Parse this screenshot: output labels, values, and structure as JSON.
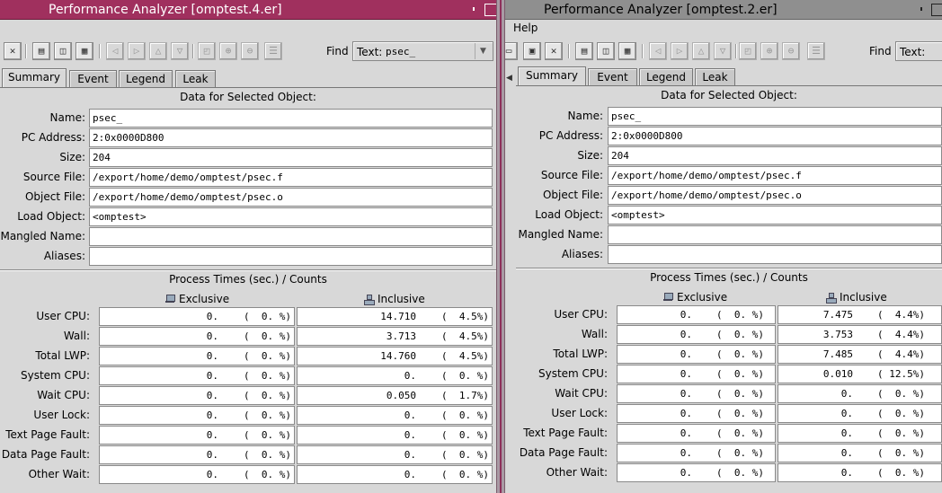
{
  "panels": [
    {
      "id": "A",
      "window_title": "Performance Analyzer [omptest.4.er]",
      "menu": null,
      "find": {
        "label": "Find",
        "text_label": "Text:",
        "value": "psec_"
      },
      "tabs": [
        "Summary",
        "Event",
        "Legend",
        "Leak"
      ],
      "selected_tab": "Summary",
      "object_section_title": "Data for Selected Object:",
      "fields": [
        {
          "label": "Name:",
          "value": "psec_"
        },
        {
          "label": "PC Address:",
          "value": "2:0x0000D800"
        },
        {
          "label": "Size:",
          "value": "204"
        },
        {
          "label": "Source File:",
          "value": "/export/home/demo/omptest/psec.f"
        },
        {
          "label": "Object File:",
          "value": "/export/home/demo/omptest/psec.o"
        },
        {
          "label": "Load Object:",
          "value": "<omptest>"
        },
        {
          "label": "Mangled Name:",
          "value": ""
        },
        {
          "label": "Aliases:",
          "value": ""
        }
      ],
      "metrics_section_title": "Process Times (sec.) / Counts",
      "exclusive_header": "Exclusive",
      "inclusive_header": "Inclusive",
      "metrics": [
        {
          "label": "User CPU:",
          "excl": "0.",
          "excl_pct": "(  0. %)",
          "incl": "14.710",
          "incl_pct": "(  4.5%)"
        },
        {
          "label": "Wall:",
          "excl": "0.",
          "excl_pct": "(  0. %)",
          "incl": "3.713",
          "incl_pct": "(  4.5%)"
        },
        {
          "label": "Total LWP:",
          "excl": "0.",
          "excl_pct": "(  0. %)",
          "incl": "14.760",
          "incl_pct": "(  4.5%)"
        },
        {
          "label": "System CPU:",
          "excl": "0.",
          "excl_pct": "(  0. %)",
          "incl": "0.",
          "incl_pct": "(  0. %)"
        },
        {
          "label": "Wait CPU:",
          "excl": "0.",
          "excl_pct": "(  0. %)",
          "incl": "0.050",
          "incl_pct": "(  1.7%)"
        },
        {
          "label": "User Lock:",
          "excl": "0.",
          "excl_pct": "(  0. %)",
          "incl": "0.",
          "incl_pct": "(  0. %)"
        },
        {
          "label": "Text Page Fault:",
          "excl": "0.",
          "excl_pct": "(  0. %)",
          "incl": "0.",
          "incl_pct": "(  0. %)"
        },
        {
          "label": "Data Page Fault:",
          "excl": "0.",
          "excl_pct": "(  0. %)",
          "incl": "0.",
          "incl_pct": "(  0. %)"
        },
        {
          "label": "Other Wait:",
          "excl": "0.",
          "excl_pct": "(  0. %)",
          "incl": "0.",
          "incl_pct": "(  0. %)"
        }
      ]
    },
    {
      "id": "B",
      "window_title": "Performance Analyzer [omptest.2.er]",
      "menu": "Help",
      "find": {
        "label": "Find",
        "text_label": "Text:",
        "value": ""
      },
      "tabs": [
        "Summary",
        "Event",
        "Legend",
        "Leak"
      ],
      "selected_tab": "Summary",
      "object_section_title": "Data for Selected Object:",
      "fields": [
        {
          "label": "Name:",
          "value": "psec_"
        },
        {
          "label": "PC Address:",
          "value": "2:0x0000D800"
        },
        {
          "label": "Size:",
          "value": "204"
        },
        {
          "label": "Source File:",
          "value": "/export/home/demo/omptest/psec.f"
        },
        {
          "label": "Object File:",
          "value": "/export/home/demo/omptest/psec.o"
        },
        {
          "label": "Load Object:",
          "value": "<omptest>"
        },
        {
          "label": "Mangled Name:",
          "value": ""
        },
        {
          "label": "Aliases:",
          "value": ""
        }
      ],
      "metrics_section_title": "Process Times (sec.) / Counts",
      "exclusive_header": "Exclusive",
      "inclusive_header": "Inclusive",
      "metrics": [
        {
          "label": "User CPU:",
          "excl": "0.",
          "excl_pct": "(  0. %)",
          "incl": "7.475",
          "incl_pct": "(  4.4%)"
        },
        {
          "label": "Wall:",
          "excl": "0.",
          "excl_pct": "(  0. %)",
          "incl": "3.753",
          "incl_pct": "(  4.4%)"
        },
        {
          "label": "Total LWP:",
          "excl": "0.",
          "excl_pct": "(  0. %)",
          "incl": "7.485",
          "incl_pct": "(  4.4%)"
        },
        {
          "label": "System CPU:",
          "excl": "0.",
          "excl_pct": "(  0. %)",
          "incl": "0.010",
          "incl_pct": "( 12.5%)"
        },
        {
          "label": "Wait CPU:",
          "excl": "0.",
          "excl_pct": "(  0. %)",
          "incl": "0.",
          "incl_pct": "(  0. %)"
        },
        {
          "label": "User Lock:",
          "excl": "0.",
          "excl_pct": "(  0. %)",
          "incl": "0.",
          "incl_pct": "(  0. %)"
        },
        {
          "label": "Text Page Fault:",
          "excl": "0.",
          "excl_pct": "(  0. %)",
          "incl": "0.",
          "incl_pct": "(  0. %)"
        },
        {
          "label": "Data Page Fault:",
          "excl": "0.",
          "excl_pct": "(  0. %)",
          "incl": "0.",
          "incl_pct": "(  0. %)"
        },
        {
          "label": "Other Wait:",
          "excl": "0.",
          "excl_pct": "(  0. %)",
          "incl": "0.",
          "incl_pct": "(  0. %)"
        }
      ]
    }
  ],
  "colors": {
    "active_title": "#a0305e",
    "inactive_title": "#8f8f8f",
    "panel_bg": "#d8d8d8",
    "field_bg": "#ffffff"
  }
}
